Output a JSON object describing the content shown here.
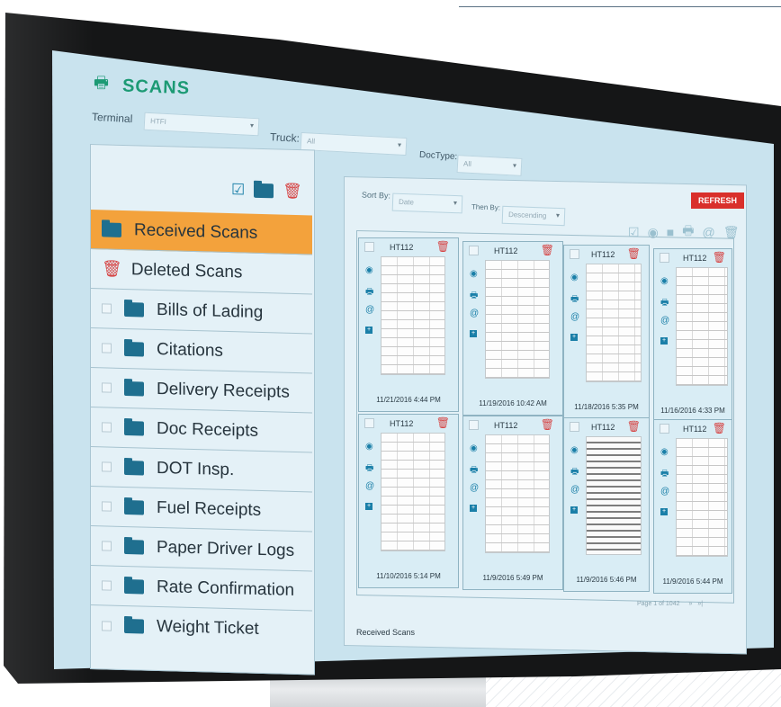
{
  "app": {
    "title": "SCANS",
    "icon": "printer-icon",
    "accent": "#1c9a74"
  },
  "filters": {
    "terminal_label": "Terminal",
    "terminal_value": "HTFI",
    "truck_label": "Truck:",
    "truck_value": "All",
    "doctype_label": "DocType:",
    "doctype_value": "All"
  },
  "sort": {
    "sort_label": "Sort By:",
    "sort_value": "Date",
    "then_label": "Then By:",
    "then_value": "Descending",
    "refresh_label": "REFRESH"
  },
  "sidebar": {
    "received": "Received Scans",
    "deleted": "Deleted Scans",
    "items": [
      "Bills of Lading",
      "Citations",
      "Delivery Receipts",
      "Doc Receipts",
      "DOT Insp.",
      "Fuel Receipts",
      "Paper Driver Logs",
      "Rate Confirmation",
      "Weight Ticket"
    ]
  },
  "cards": [
    {
      "id": "HT112",
      "date": "11/21/2016 4:44 PM"
    },
    {
      "id": "HT112",
      "date": "11/19/2016 10:42 AM"
    },
    {
      "id": "HT112",
      "date": "11/18/2016 5:35 PM"
    },
    {
      "id": "HT112",
      "date": "11/16/2016 4:33 PM"
    },
    {
      "id": "HT112",
      "date": "11/10/2016 5:14 PM"
    },
    {
      "id": "HT112",
      "date": "11/9/2016 5:49 PM"
    },
    {
      "id": "HT112",
      "date": "11/9/2016 5:46 PM"
    },
    {
      "id": "HT112",
      "date": "11/9/2016 5:44 PM"
    }
  ],
  "pager": {
    "text": "Page 1 of 1042"
  },
  "footer": {
    "text": "Received Scans"
  }
}
